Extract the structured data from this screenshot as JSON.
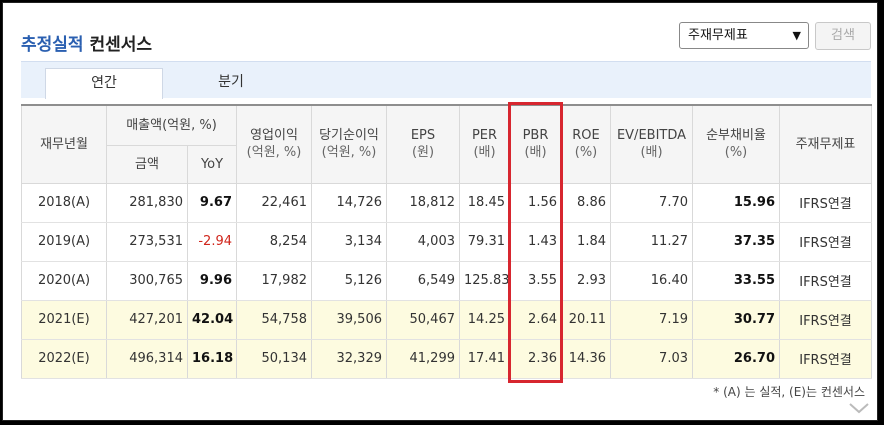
{
  "header": {
    "title_accent": "추정실적",
    "title_rest": "컨센서스",
    "select_value": "주재무제표",
    "search_button": "검색"
  },
  "tabs": [
    {
      "label": "연간",
      "active": true
    },
    {
      "label": "분기",
      "active": false
    }
  ],
  "table": {
    "col_date": "재무년월",
    "col_sales_group": "매출액(억원, %)",
    "col_sales_amount": "금액",
    "col_sales_yoy": "YoY",
    "col_op_income": "영업이익",
    "col_op_income_unit": "(억원, %)",
    "col_net_income": "당기순이익",
    "col_net_income_unit": "(억원, %)",
    "col_eps": "EPS",
    "col_eps_unit": "(원)",
    "col_per": "PER",
    "col_per_unit": "(배)",
    "col_pbr": "PBR",
    "col_pbr_unit": "(배)",
    "col_roe": "ROE",
    "col_roe_unit": "(%)",
    "col_ev": "EV/EBITDA",
    "col_ev_unit": "(배)",
    "col_debt": "순부채비율",
    "col_debt_unit": "(%)",
    "col_std": "주재무제표",
    "rows": [
      {
        "date": "2018(A)",
        "sales": "281,830",
        "yoy": "9.67",
        "op": "22,461",
        "net": "14,726",
        "eps": "18,812",
        "per": "18.45",
        "pbr": "1.56",
        "roe": "8.86",
        "ev": "7.70",
        "debt": "15.96",
        "std": "IFRS연결"
      },
      {
        "date": "2019(A)",
        "sales": "273,531",
        "yoy": "-2.94",
        "op": "8,254",
        "net": "3,134",
        "eps": "4,003",
        "per": "79.31",
        "pbr": "1.43",
        "roe": "1.84",
        "ev": "11.27",
        "debt": "37.35",
        "std": "IFRS연결"
      },
      {
        "date": "2020(A)",
        "sales": "300,765",
        "yoy": "9.96",
        "op": "17,982",
        "net": "5,126",
        "eps": "6,549",
        "per": "125.83",
        "pbr": "3.55",
        "roe": "2.93",
        "ev": "16.40",
        "debt": "33.55",
        "std": "IFRS연결"
      },
      {
        "date": "2021(E)",
        "sales": "427,201",
        "yoy": "42.04",
        "op": "54,758",
        "net": "39,506",
        "eps": "50,467",
        "per": "14.25",
        "pbr": "2.64",
        "roe": "20.11",
        "ev": "7.19",
        "debt": "30.77",
        "std": "IFRS연결"
      },
      {
        "date": "2022(E)",
        "sales": "496,314",
        "yoy": "16.18",
        "op": "50,134",
        "net": "32,329",
        "eps": "41,299",
        "per": "17.41",
        "pbr": "2.36",
        "roe": "14.36",
        "ev": "7.03",
        "debt": "26.70",
        "std": "IFRS연결"
      }
    ]
  },
  "footnote": "* (A) 는 실적, (E)는 컨센서스",
  "colors": {
    "accent": "#2a5fb0",
    "highlight_box": "#d7262f",
    "negative": "#d0261c",
    "estimate_row_bg": "#fdfbe0"
  }
}
